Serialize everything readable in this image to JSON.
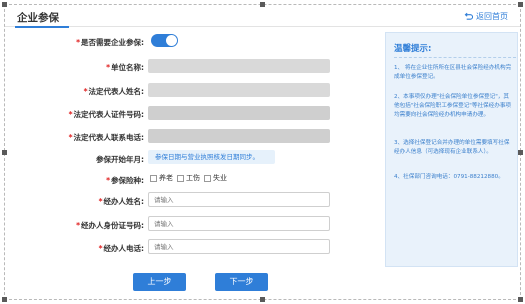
{
  "header": {
    "title": "企业参保",
    "back_label": "返回首页"
  },
  "form": {
    "need_insurance_label": "是否需要企业参保:",
    "unit_name_label": "单位名称:",
    "legal_name_label": "法定代表人姓名:",
    "legal_id_label": "法定代表人证件号码:",
    "legal_phone_label": "法定代表人联系电话:",
    "start_month_label": "参保开始年月:",
    "start_month_info": "参保日期与营业执照核发日期同步。",
    "insurance_type_label": "参保险种:",
    "insurance_types": [
      "养老",
      "工伤",
      "失业"
    ],
    "handler_name_label": "经办人姓名:",
    "handler_name_placeholder": "请输入",
    "handler_id_label": "经办人身份证号码:",
    "handler_id_placeholder": "请输入",
    "handler_phone_label": "经办人电话:",
    "handler_phone_placeholder": "请输入",
    "required_mark": "*"
  },
  "buttons": {
    "prev_label": "上一步",
    "next_label": "下一步"
  },
  "tips": {
    "title": "温馨提示:",
    "items": [
      "1、 将在企业住所所在区县社会保险经办机构完成单位参保登记。",
      "2、本事项仅办理\"社会保险单位参保登记\"，其他包括\"社会保险职工参保登记\"等社保经办事项均需要向社会保险经办机构申请办理。",
      "3、选择社保登记合并办理的单位需要填写社保经办人信息（可选择现有企业联系人）。",
      "4、社保部门咨询电话：0791-88212880。"
    ]
  },
  "colors": {
    "accent": "#2f7ed8",
    "required": "#e02020",
    "tip_background": "#e9f2fb"
  }
}
